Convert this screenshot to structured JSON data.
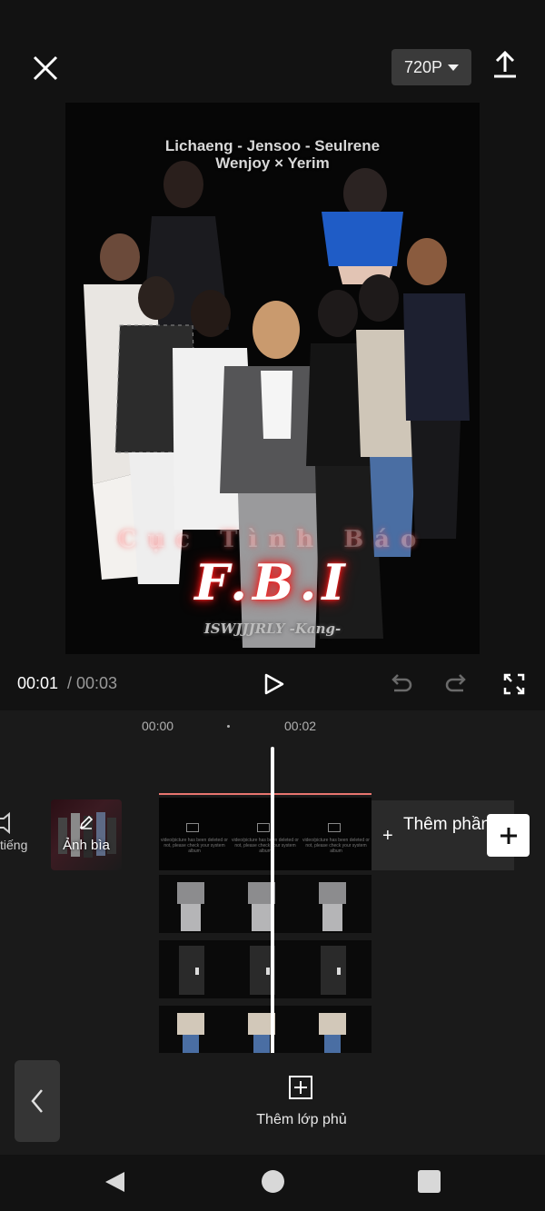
{
  "topbar": {
    "close_icon": "close-icon",
    "resolution": "720P",
    "export_icon": "upload-icon"
  },
  "preview": {
    "credits_line1": "Lichaeng - Jensoo - Seulrene",
    "credits_line2": "Wenjoy × Yerim",
    "subtitle": "Cục Tình Báo",
    "title": "F.B.I",
    "signature": "ISWJJJRLY -Kang-"
  },
  "playback": {
    "current_time": "00:01",
    "total_time": "/ 00:03"
  },
  "timeline": {
    "ruler": [
      "00:00",
      "00:02"
    ],
    "audio_label": "tiếng",
    "cover_label": "Ảnh bìa",
    "clip_placeholder_text": "video/picture has been deleted or not, please check your system album",
    "add_end_label": "Thêm phần kết"
  },
  "bottom": {
    "overlay_label": "Thêm lớp phủ"
  },
  "colors": {
    "background": "#121212",
    "panel": "#1a1a1a",
    "track_accent": "#e8756f",
    "title_glow": "#ff2020"
  }
}
